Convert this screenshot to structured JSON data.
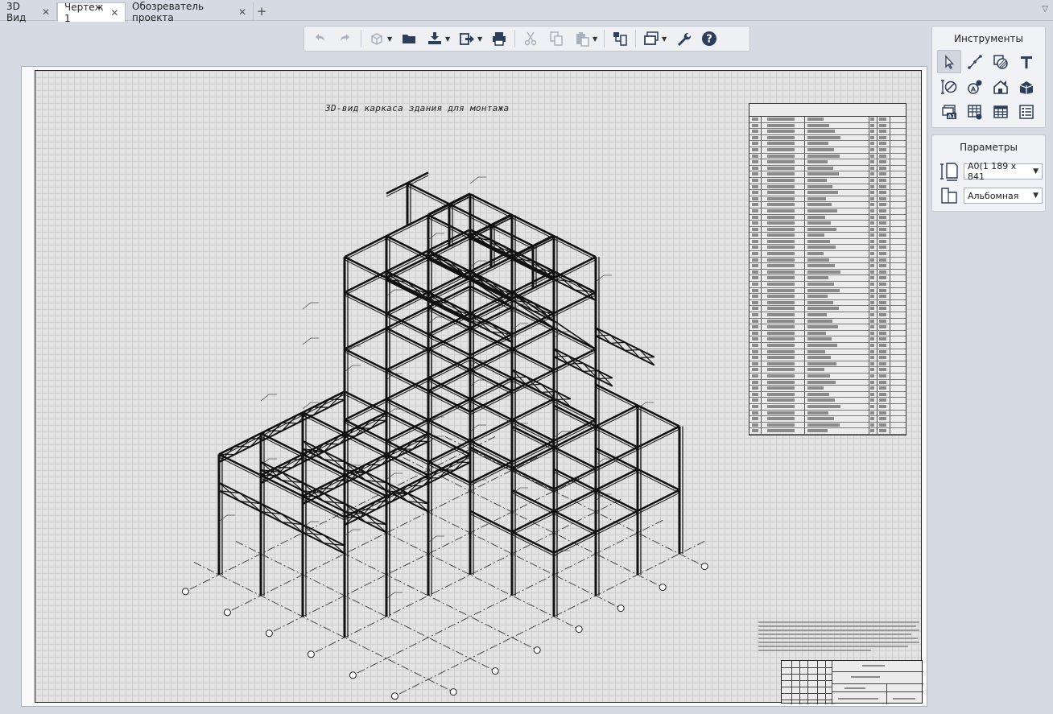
{
  "tabs": [
    {
      "label": "3D Вид",
      "active": false
    },
    {
      "label": "Чертеж 1",
      "active": true
    },
    {
      "label": "Обозреватель проекта",
      "active": false
    }
  ],
  "tab_add_glyph": "+",
  "tab_close_glyph": "✕",
  "tab_menu_glyph": "▽",
  "toolbar": {
    "buttons": [
      "undo-icon",
      "redo-icon",
      "3d-view-icon",
      "open-folder-icon",
      "import-icon",
      "export-icon",
      "print-icon",
      "cut-icon",
      "copy-icon",
      "paste-icon",
      "layout-icon",
      "sheets-icon",
      "settings-wrench-icon",
      "help-icon"
    ]
  },
  "drawing": {
    "title": "3D-вид каркаса здания для монтажа"
  },
  "tools_panel": {
    "title": "Инструменты",
    "tools": [
      "select-icon",
      "line-icon",
      "hatch-icon",
      "text-icon",
      "dimension-icon",
      "callout-icon",
      "section-view-icon",
      "3d-view-insert-icon",
      "label-icon",
      "schedule-icon",
      "table-icon",
      "list-icon"
    ]
  },
  "params_panel": {
    "title": "Параметры",
    "sheet_format": "A0(1 189 x 841",
    "orientation": "Альбомная"
  },
  "colors": {
    "accent": "#3a5a8c",
    "background": "#d6dbe3",
    "panel": "#f0f2f5"
  }
}
